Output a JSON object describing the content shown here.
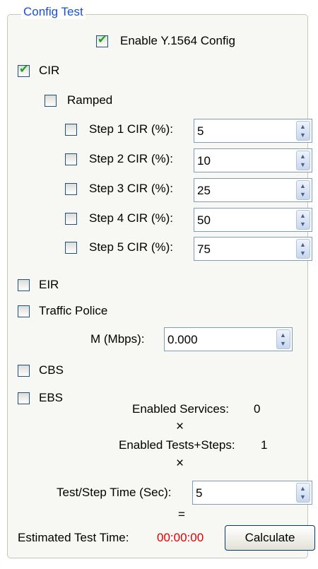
{
  "groupbox_title": "Config Test",
  "enable_y1564": {
    "label": "Enable Y.1564 Config",
    "checked": true
  },
  "cir": {
    "label": "CIR",
    "checked": true
  },
  "ramped": {
    "label": "Ramped",
    "checked": false
  },
  "steps": [
    {
      "label": "Step 1 CIR (%):",
      "value": "5",
      "checked": false
    },
    {
      "label": "Step 2 CIR (%):",
      "value": "10",
      "checked": false
    },
    {
      "label": "Step 3 CIR (%):",
      "value": "25",
      "checked": false
    },
    {
      "label": "Step 4 CIR (%):",
      "value": "50",
      "checked": false
    },
    {
      "label": "Step 5 CIR (%):",
      "value": "75",
      "checked": false
    }
  ],
  "eir": {
    "label": "EIR",
    "checked": false
  },
  "traffic_police": {
    "label": "Traffic Police",
    "checked": false
  },
  "m_mbps": {
    "label": "M (Mbps):",
    "value": "0.000"
  },
  "cbs": {
    "label": "CBS",
    "checked": false
  },
  "ebs": {
    "label": "EBS",
    "checked": false
  },
  "enabled_services": {
    "label": "Enabled Services:",
    "value": "0"
  },
  "times_symbol": "×",
  "enabled_tests_steps": {
    "label": "Enabled Tests+Steps:",
    "value": "1"
  },
  "test_step_time": {
    "label": "Test/Step Time (Sec):",
    "value": "5"
  },
  "equals_symbol": "=",
  "estimated_test_time": {
    "label": "Estimated Test Time:",
    "value": "00:00:00",
    "value_color": "#e00000"
  },
  "calculate_button": "Calculate"
}
